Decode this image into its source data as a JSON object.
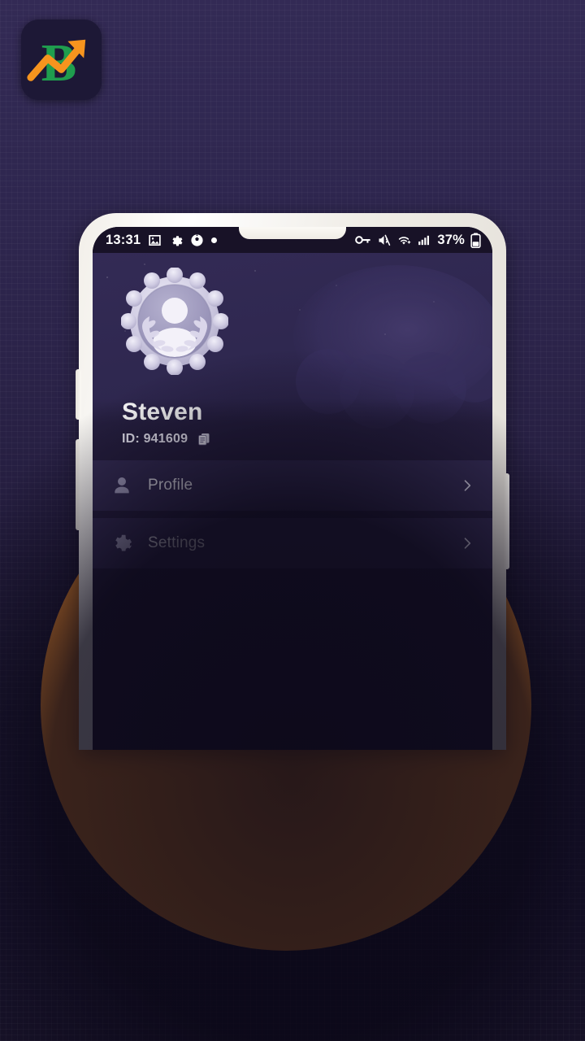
{
  "app": {
    "logo_icon": "b-arrow-growth-logo",
    "logo_letter": "B",
    "brand_green": "#1f9d4e",
    "brand_orange": "#f7941e",
    "logo_tile_bg": "#1d1836"
  },
  "backdrop": {
    "accent_circle_color": "#fb9330",
    "page_bg_top": "#332a55",
    "page_bg_bottom": "#171228"
  },
  "phone": {
    "frame_color": "#f4f1ea",
    "screen_bg": "#241d3c"
  },
  "status_bar": {
    "time": "13:31",
    "left_icons": [
      "image-icon",
      "gear-icon",
      "soccer-ball-icon",
      "dot-icon"
    ],
    "right_icons": [
      "vpn-key-icon",
      "volume-mute-icon",
      "wifi-icon",
      "cellular-signal-icon"
    ],
    "battery_percent": "37%",
    "battery_icon": "battery-icon",
    "bg": "#181227"
  },
  "profile": {
    "avatar_icon": "laurel-badge-avatar",
    "name": "Steven",
    "id_label": "ID: 941609",
    "copy_icon": "copy-icon"
  },
  "menu": {
    "items": [
      {
        "label": "Profile",
        "icon": "person-icon",
        "chevron": "chevron-right-icon"
      },
      {
        "label": "Settings",
        "icon": "gear-icon",
        "chevron": "chevron-right-icon"
      }
    ],
    "item_bg": "#332b52",
    "text_color": "#efeef6"
  }
}
